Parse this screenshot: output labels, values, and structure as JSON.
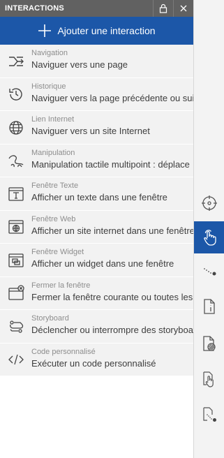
{
  "panel": {
    "title": "INTERACTIONS",
    "lock_icon": "lock-icon",
    "close_icon": "close-icon",
    "add_button_label": "Ajouter une interaction",
    "accent_color": "#1c57a8",
    "header_color": "#616161"
  },
  "interactions": [
    {
      "category": "Navigation",
      "description": "Naviguer vers une page",
      "icon": "navigation-icon"
    },
    {
      "category": "Historique",
      "description": "Naviguer vers la page précédente ou sui",
      "icon": "history-icon"
    },
    {
      "category": "Lien Internet",
      "description": "Naviguer vers un site Internet",
      "icon": "globe-icon"
    },
    {
      "category": "Manipulation",
      "description": "Manipulation tactile multipoint : déplace",
      "icon": "multitouch-icon"
    },
    {
      "category": "Fenêtre Texte",
      "description": "Afficher un texte dans une fenêtre",
      "icon": "text-window-icon"
    },
    {
      "category": "Fenêtre Web",
      "description": "Afficher un site internet dans une fenêtre",
      "icon": "web-window-icon"
    },
    {
      "category": "Fenêtre Widget",
      "description": "Afficher un widget dans une fenêtre",
      "icon": "widget-window-icon"
    },
    {
      "category": "Fermer la fenêtre",
      "description": "Fermer la fenêtre courante ou toutes les",
      "icon": "close-window-icon"
    },
    {
      "category": "Storyboard",
      "description": "Déclencher ou interrompre des storyboa",
      "icon": "storyboard-icon"
    },
    {
      "category": "Code personnalisé",
      "description": "Exécuter un code personnalisé",
      "icon": "code-icon"
    }
  ],
  "rail": [
    {
      "icon": "target-icon",
      "active": false
    },
    {
      "icon": "touch-hand-icon",
      "active": true
    },
    {
      "icon": "motion-path-icon",
      "active": false
    },
    {
      "icon": "page-info-icon",
      "active": false
    },
    {
      "icon": "page-pattern-icon",
      "active": false
    },
    {
      "icon": "page-touch-icon",
      "active": false
    },
    {
      "icon": "page-motion-icon",
      "active": false
    }
  ]
}
